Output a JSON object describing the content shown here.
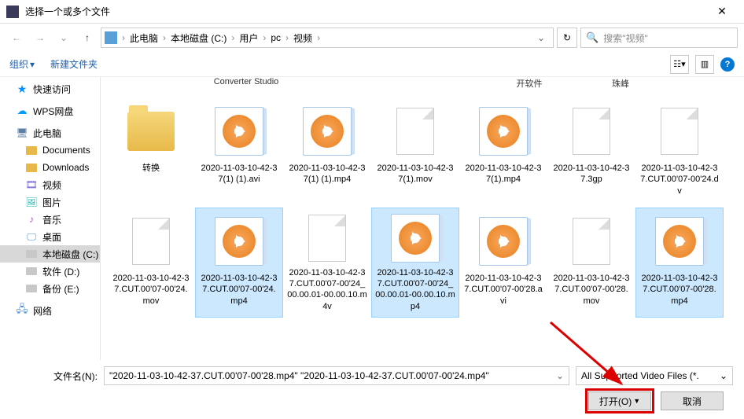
{
  "titlebar": {
    "title": "选择一个或多个文件"
  },
  "nav": {
    "breadcrumb": [
      "此电脑",
      "本地磁盘 (C:)",
      "用户",
      "pc",
      "视频"
    ],
    "search_placeholder": "搜索\"视频\""
  },
  "toolbar": {
    "organize": "组织",
    "newfolder": "新建文件夹"
  },
  "sidebar": {
    "quick": "快速访问",
    "wps": "WPS网盘",
    "thispc": "此电脑",
    "documents": "Documents",
    "downloads": "Downloads",
    "video": "视频",
    "pictures": "图片",
    "music": "音乐",
    "desktop": "桌面",
    "drive_c": "本地磁盘 (C:)",
    "drive_d": "软件 (D:)",
    "drive_e": "备份 (E:)",
    "network": "网络"
  },
  "header_frags": {
    "a": "Converter Studio",
    "b": "开软件",
    "c": "珠峰"
  },
  "files": {
    "r1": [
      {
        "type": "folder",
        "label": "转换",
        "sel": false
      },
      {
        "type": "video",
        "label": "2020-11-03-10-42-37(1) (1).avi",
        "sel": false
      },
      {
        "type": "video",
        "label": "2020-11-03-10-42-37(1) (1).mp4",
        "sel": false
      },
      {
        "type": "doc",
        "label": "2020-11-03-10-42-37(1).mov",
        "sel": false
      },
      {
        "type": "video",
        "label": "2020-11-03-10-42-37(1).mp4",
        "sel": false
      },
      {
        "type": "doc",
        "label": "2020-11-03-10-42-37.3gp",
        "sel": false
      },
      {
        "type": "doc",
        "label": "2020-11-03-10-42-37.CUT.00'07-00'24.dv",
        "sel": false
      }
    ],
    "r2": [
      {
        "type": "doc",
        "label": "2020-11-03-10-42-37.CUT.00'07-00'24.mov",
        "sel": false
      },
      {
        "type": "video",
        "label": "2020-11-03-10-42-37.CUT.00'07-00'24.mp4",
        "sel": true
      },
      {
        "type": "doc",
        "label": "2020-11-03-10-42-37.CUT.00'07-00'24_00.00.01-00.00.10.m4v",
        "sel": false
      },
      {
        "type": "video",
        "label": "2020-11-03-10-42-37.CUT.00'07-00'24_00.00.01-00.00.10.mp4",
        "sel": true
      },
      {
        "type": "video",
        "label": "2020-11-03-10-42-37.CUT.00'07-00'28.avi",
        "sel": false
      },
      {
        "type": "doc",
        "label": "2020-11-03-10-42-37.CUT.00'07-00'28.mov",
        "sel": false
      },
      {
        "type": "video",
        "label": "2020-11-03-10-42-37.CUT.00'07-00'28.mp4",
        "sel": true
      }
    ]
  },
  "bottom": {
    "filename_label": "文件名(N):",
    "filename_value": "\"2020-11-03-10-42-37.CUT.00'07-00'28.mp4\" \"2020-11-03-10-42-37.CUT.00'07-00'24.mp4\"",
    "filter": "All Supported Video Files (*.",
    "open": "打开(O)",
    "cancel": "取消"
  }
}
